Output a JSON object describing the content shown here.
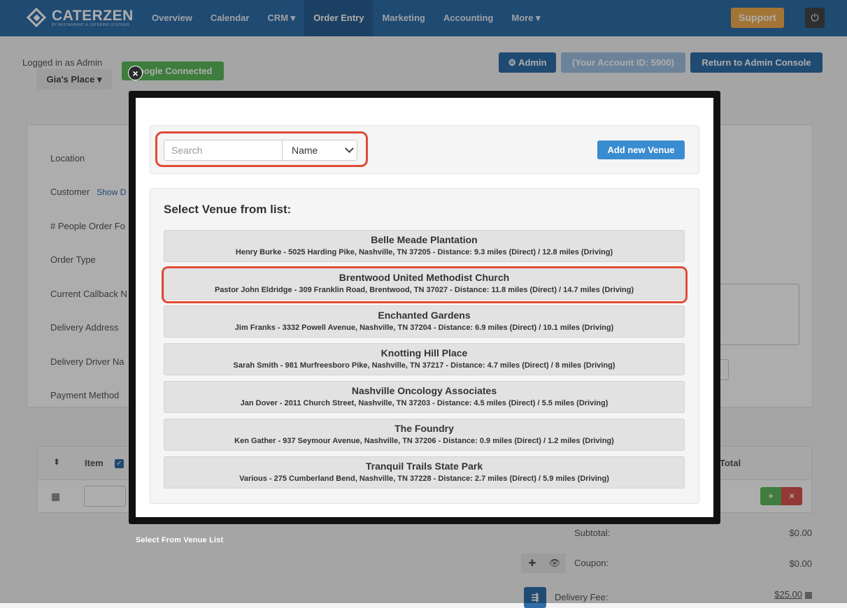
{
  "nav": {
    "brand": "CATERZEN",
    "brand_sub": "BY RESTAURANT & CATERING SYSTEMS",
    "items": [
      {
        "label": "Overview"
      },
      {
        "label": "Calendar"
      },
      {
        "label": "CRM ▾"
      },
      {
        "label": "Order Entry"
      },
      {
        "label": "Marketing"
      },
      {
        "label": "Accounting"
      },
      {
        "label": "More ▾"
      }
    ],
    "active": "Order Entry",
    "support": "Support",
    "power_icon": "⏻"
  },
  "header": {
    "logged_in": "Logged in as Admin",
    "place": "Gia's Place ▾",
    "google": "oogle Connected",
    "admin": "⚙ Admin",
    "account": "(Your Account ID: 5900)",
    "return": "Return to Admin Console"
  },
  "form": {
    "labels": [
      {
        "label": "Location"
      },
      {
        "label": "Customer"
      },
      {
        "label": "# People Order Fo"
      },
      {
        "label": "Order Type"
      },
      {
        "label": "Current Callback N"
      },
      {
        "label": "Delivery Address"
      },
      {
        "label": "Delivery Driver Na"
      },
      {
        "label": "Payment Method"
      }
    ],
    "show_link": "Show D"
  },
  "items": {
    "col_item": "Item",
    "col_total": "Total",
    "sort_icon": "⬍",
    "grid_icon": "▦",
    "add": "+",
    "remove": "×"
  },
  "summary": {
    "subtotal_label": "Subtotal:",
    "subtotal_value": "$0.00",
    "coupon_label": "Coupon:",
    "coupon_value": "$0.00",
    "delivery_label": "Delivery Fee:",
    "delivery_value": "$25.00"
  },
  "modal": {
    "close": "×",
    "caption": "Select From Venue List",
    "search_placeholder": "Search",
    "search_by": "Name",
    "add_button": "Add new Venue",
    "list_title": "Select Venue from list:",
    "venues": [
      {
        "name": "Belle Meade Plantation",
        "detail": "Henry Burke - 5025 Harding Pike, Nashville, TN 37205 - Distance: 9.3 miles (Direct) / 12.8 miles (Driving)"
      },
      {
        "name": "Brentwood United Methodist Church",
        "detail": "Pastor John Eldridge - 309 Franklin Road, Brentwood, TN 37027 - Distance: 11.8 miles (Direct) / 14.7 miles (Driving)"
      },
      {
        "name": "Enchanted Gardens",
        "detail": "Jim Franks - 3332 Powell Avenue, Nashville, TN 37204 - Distance: 6.9 miles (Direct) / 10.1 miles (Driving)"
      },
      {
        "name": "Knotting Hill Place",
        "detail": "Sarah Smith - 981 Murfreesboro Pike, Nashville, TN 37217 - Distance: 4.7 miles (Direct) / 8 miles (Driving)"
      },
      {
        "name": "Nashville Oncology Associates",
        "detail": "Jan Dover - 2011 Church Street, Nashville, TN 37203 - Distance: 4.5 miles (Direct) / 5.5 miles (Driving)"
      },
      {
        "name": "The Foundry",
        "detail": "Ken Gather - 937 Seymour Avenue, Nashville, TN 37206 - Distance: 0.9 miles (Direct) / 1.2 miles (Driving)"
      },
      {
        "name": "Tranquil Trails State Park",
        "detail": "Various - 275 Cumberland Bend, Nashville, TN 37228 - Distance: 2.7 miles (Direct) / 5.9 miles (Driving)"
      }
    ],
    "highlight_color": "#e04b36"
  },
  "colors": {
    "brand": "#2f6ea8",
    "support": "#f0ad4e",
    "success": "#5cb85c",
    "danger": "#d9534f"
  }
}
